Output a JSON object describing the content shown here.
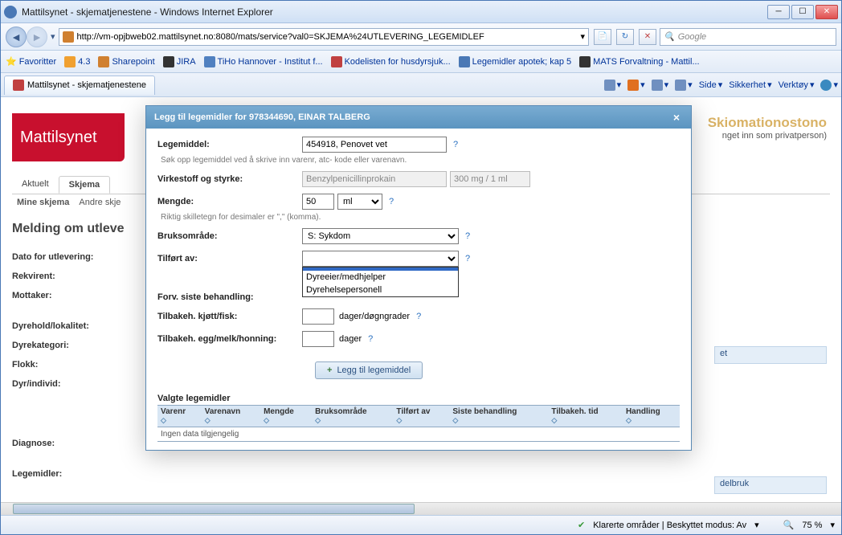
{
  "window": {
    "title": "Mattilsynet - skjematjenestene - Windows Internet Explorer"
  },
  "nav": {
    "url": "http://vm-opjbweb02.mattilsynet.no:8080/mats/service?val0=SKJEMA%24UTLEVERING_LEGEMIDLEF",
    "search_placeholder": "Google"
  },
  "favorites": {
    "label": "Favoritter",
    "items": [
      "4.3",
      "Sharepoint",
      "JIRA",
      "TiHo Hannover - Institut f...",
      "Kodelisten for husdyrsjuk...",
      "Legemidler apotek; kap 5",
      "MATS Forvaltning - Mattil..."
    ]
  },
  "page_tab": {
    "label": "Mattilsynet - skjematjenestene"
  },
  "toolbar": {
    "side": "Side",
    "sikkerhet": "Sikkerhet",
    "verktoy": "Verktøy"
  },
  "bg": {
    "logo": "Mattilsynet",
    "tabs": [
      "Aktuelt",
      "Skjema"
    ],
    "subtabs": [
      "Mine skjema",
      "Andre skje"
    ],
    "heading": "Melding om utleve",
    "login_hint": "nget inn som privatperson)",
    "topright_partial": "Skiomationostono",
    "labels": {
      "dato": "Dato for utlevering:",
      "rekvirent": "Rekvirent:",
      "mottaker": "Mottaker:",
      "dyrehold": "Dyrehold/lokalitet:",
      "dyrekategori": "Dyrekategori:",
      "flokk": "Flokk:",
      "dyrindivid": "Dyr/individ:",
      "diagnose": "Diagnose:",
      "legemidler": "Legemidler:"
    },
    "right_stub1": "et",
    "right_stub2": "delbruk"
  },
  "modal": {
    "title": "Legg til legemidler for 978344690, EINAR TALBERG",
    "rows": {
      "legemiddel": {
        "label": "Legemiddel:",
        "value": "454918, Penovet vet",
        "hint": "Søk opp legemiddel ved å skrive inn varenr, atc- kode eller varenavn."
      },
      "virkestoff": {
        "label": "Virkestoff og styrke:",
        "value1": "Benzylpenicillinprokain",
        "value2": "300 mg / 1 ml"
      },
      "mengde": {
        "label": "Mengde:",
        "value": "50",
        "unit": "ml",
        "hint": "Riktig skilletegn for desimaler er \",\" (komma)."
      },
      "bruksomrade": {
        "label": "Bruksområde:",
        "value": "S: Sykdom"
      },
      "tilfort": {
        "label": "Tilført av:",
        "value": "",
        "options": [
          "",
          "Dyreeier/medhjelper",
          "Dyrehelsepersonell"
        ]
      },
      "forv": {
        "label": "Forv. siste behandling:"
      },
      "tilbak_kjott": {
        "label": "Tilbakeh. kjøtt/fisk:",
        "value": "",
        "suffix": "dager/døgngrader"
      },
      "tilbak_egg": {
        "label": "Tilbakeh. egg/melk/honning:",
        "value": "",
        "suffix": "dager"
      }
    },
    "add_button": "Legg til legemiddel",
    "table": {
      "heading": "Valgte legemidler",
      "cols": [
        "Varenr",
        "Varenavn",
        "Mengde",
        "Bruksområde",
        "Tilført av",
        "Siste behandling",
        "Tilbakeh. tid",
        "Handling"
      ],
      "empty": "Ingen data tilgjengelig"
    }
  },
  "status": {
    "klarerte": "Klarerte områder | Beskyttet modus: Av",
    "zoom": "75 %"
  }
}
